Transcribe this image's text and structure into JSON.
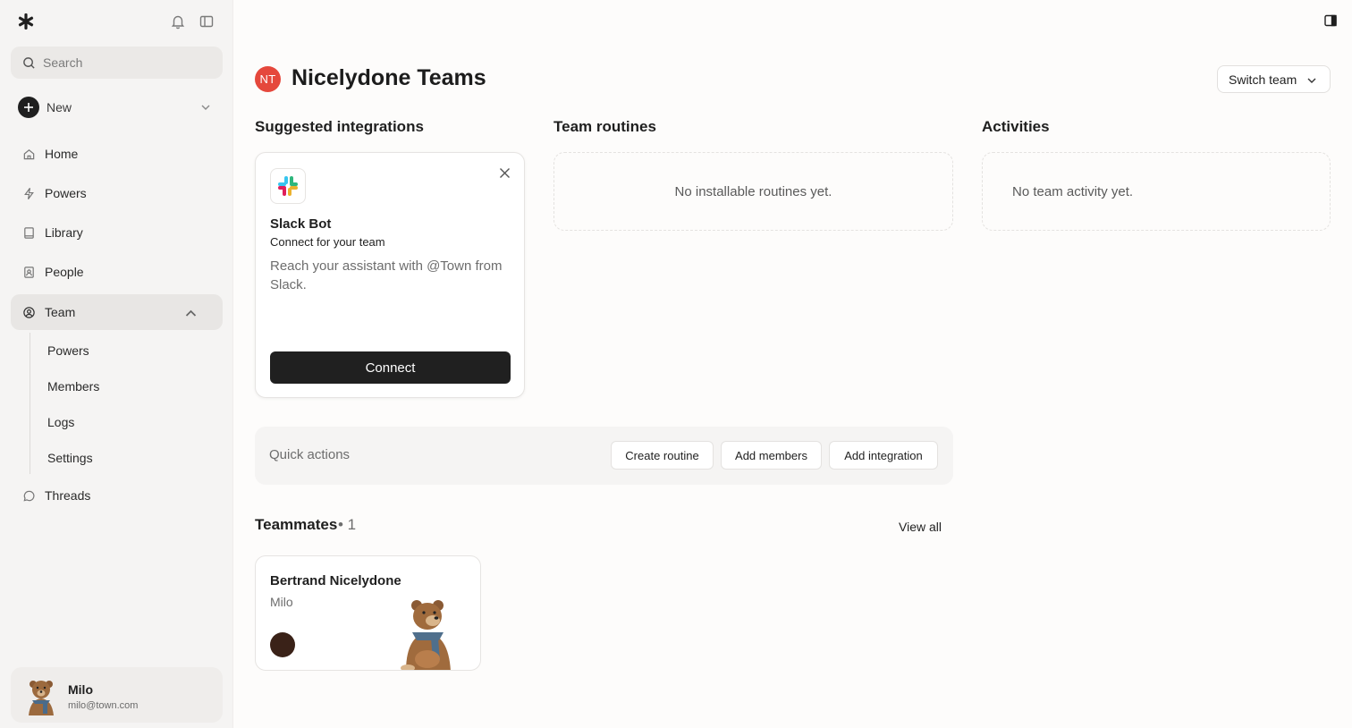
{
  "sidebar": {
    "search_placeholder": "Search",
    "new_label": "New",
    "nav": {
      "home": "Home",
      "powers": "Powers",
      "library": "Library",
      "people": "People",
      "team": "Team",
      "threads": "Threads"
    },
    "team_sub": [
      "Powers",
      "Members",
      "Logs",
      "Settings"
    ],
    "user": {
      "name": "Milo",
      "email": "milo@town.com"
    }
  },
  "header": {
    "badge": "NT",
    "title": "Nicelydone Teams",
    "switch_label": "Switch team"
  },
  "sections": {
    "integrations": "Suggested integrations",
    "routines": "Team routines",
    "activities": "Activities"
  },
  "integration": {
    "name": "Slack Bot",
    "subtitle": "Connect for your team",
    "description": "Reach your assistant with @Town from Slack.",
    "connect_label": "Connect"
  },
  "routines_empty": "No installable routines yet.",
  "activities_empty": "No team activity yet.",
  "quick_actions": {
    "label": "Quick actions",
    "buttons": [
      "Create routine",
      "Add members",
      "Add integration"
    ]
  },
  "teammates": {
    "title": "Teammates",
    "count": "• 1",
    "view_all": "View all",
    "members": [
      {
        "name": "Bertrand Nicelydone",
        "role": "Milo"
      }
    ]
  },
  "colors": {
    "team_badge": "#e5483c",
    "primary_button": "#202020"
  }
}
